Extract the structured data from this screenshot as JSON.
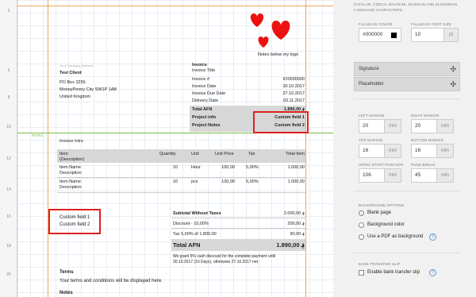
{
  "ruler": [
    "5",
    "6",
    "8",
    "10",
    "12",
    "14",
    "16",
    "18",
    "20"
  ],
  "paper": {
    "logo_caption": "Notes below my logo",
    "sender_line": "Your Company Address",
    "client_name": "Test Client",
    "client_address": [
      "PO Box 3255",
      "MoneyPenny City SW1P 1AB",
      "United Kingdom"
    ],
    "invoice_title": "Invoice",
    "invoice_subtitle": "Invoice Title",
    "meta": [
      {
        "label": "Invoice #",
        "value": "IO0000000"
      },
      {
        "label": "Invoice Date",
        "value": "20.10.2017"
      },
      {
        "label": "Invoice Due Date",
        "value": "27.10.2017"
      },
      {
        "label": "Delivery Date",
        "value": "03.11.2017"
      }
    ],
    "total_label": "Total AFN",
    "total_value": "1.890,00 ؋",
    "project_info_label": "Project info",
    "project_info_value": "Custom field 1",
    "project_notes_label": "Project Notes",
    "project_notes_value": "Custom field 2",
    "intro_tag": "INTRO",
    "invoice_intro": "Invoice Intro",
    "table_headers": {
      "item": "Item",
      "item_sub": "(Description)",
      "quantity": "Quantity",
      "unit": "Unit",
      "unit_price": "Unit Price",
      "tax": "Tax",
      "total_item": "Total Item"
    },
    "rows": [
      {
        "name": "Item Name",
        "desc": "Description",
        "qty": "10",
        "unit": "Hour",
        "price": "100,00",
        "tax": "5,00%",
        "total": "1.000,00"
      },
      {
        "name": "Item Name",
        "desc": "Description",
        "qty": "10",
        "unit": "pcs",
        "price": "100,00",
        "tax": "5,00%",
        "total": "1.000,00"
      }
    ],
    "custom_left_1": "Custom field 1",
    "custom_left_2": "Custom field 2",
    "subtotal_label": "Subtotal Without Taxes",
    "subtotal_value": "2.000,00 ؋",
    "discount_label": "Discount - 10,00%",
    "discount_value": "200,00 ؋",
    "tax_label": "Tax 5,00% of 1.800,00",
    "tax_value": "90,00 ؋",
    "grand_total_label": "Total AFN",
    "grand_total_value": "1.890,00 ؋",
    "cash_discount_1": "We grant 5% cash discount for the complete payment until",
    "cash_discount_2": "30.10.2017 (10 Days), otherwise 27.10.2017 net.",
    "terms_title": "Terms",
    "terms_text": "Your terms and conditions will be displayed here.",
    "notes_title": "Notes"
  },
  "panel": {
    "chars_1": "CATALAN, CZECH, MALTESE, RUSSIAN AND SLOVENIAN",
    "chars_2": "LANGUAGE CHARACTERS.",
    "fallback_color_label": "FALLBACK COLOR",
    "fallback_color_value": "#000000",
    "fallback_size_label": "FALLBACK FONT SIZE",
    "fallback_size_value": "10",
    "fallback_size_unit": "pt",
    "signature_label": "Signature",
    "placeholder_label": "Placeholder",
    "left_margin_label": "LEFT MARGIN",
    "left_margin_value": "20",
    "right_margin_label": "RIGHT MARGIN",
    "right_margin_value": "20",
    "top_margin_label": "TOP MARGIN",
    "top_margin_value": "16",
    "bottom_margin_label": "BOTTOM MARGIN",
    "bottom_margin_value": "16",
    "intro_start_label": "INTRO START POSITION",
    "intro_start_value": "106",
    "page_break_label": "PAGE BREAK",
    "page_break_value": "45",
    "unit_mm": "mm",
    "bg_options_label": "BACKGROUND OPTIONS",
    "bg_blank": "Blank page",
    "bg_color": "Background color",
    "bg_pdf": "Use a PDF as background",
    "bank_slip_label": "BANK TRANSFER SLIP",
    "bank_slip_option": "Enable bank transfer slip",
    "help": "?",
    "move_glyph": "✣"
  },
  "colors": {
    "accent_orange": "#e8a860",
    "intro_green": "#77bb44",
    "highlight_red": "#e02020",
    "heart_red": "#ee1111"
  }
}
